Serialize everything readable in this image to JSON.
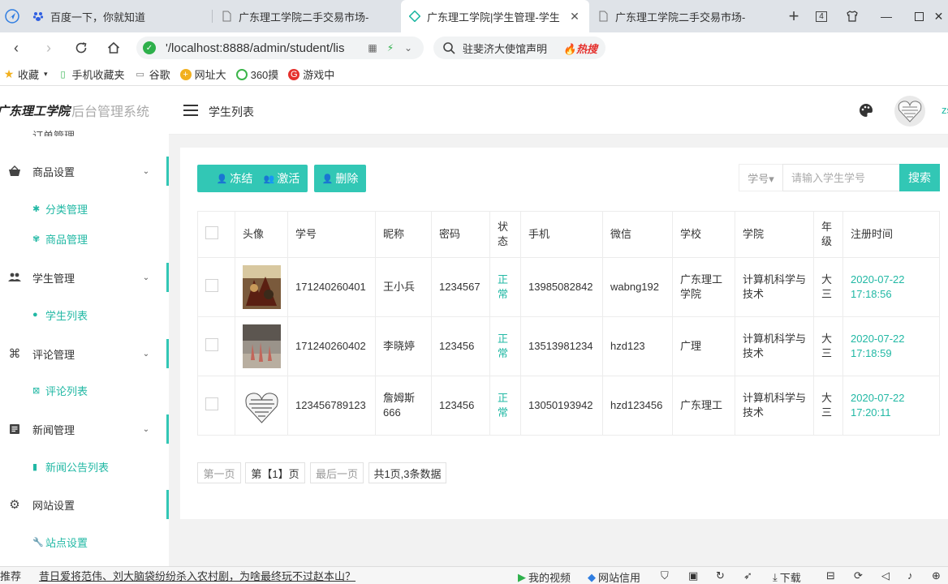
{
  "browser": {
    "tabs": [
      {
        "title": "百度一下，你就知道",
        "active": false
      },
      {
        "title": "广东理工学院二手交易市场-",
        "active": false
      },
      {
        "title": "广东理工学院|学生管理-学生",
        "active": true
      },
      {
        "title": "广东理工学院二手交易市场-",
        "active": false
      }
    ],
    "tab_count": "4",
    "url": "'/localhost:8888/admin/student/lis",
    "search_query": "驻斐济大使馆声明",
    "search_hot": "🔥热搜",
    "bookmarks": [
      "收藏",
      "手机收藏夹",
      "谷歌",
      "网址大",
      "360摸",
      "游戏中"
    ]
  },
  "app": {
    "school": "广东理工学院",
    "system_name": "后台管理系统",
    "page_title": "学生列表",
    "user_initial": "zs",
    "accent": "#32c7b5"
  },
  "sidebar": {
    "top_partial": "订单管理",
    "menus": [
      {
        "label": "商品设置",
        "icon": "basket-icon",
        "subs": [
          "分类管理",
          "商品管理"
        ]
      },
      {
        "label": "学生管理",
        "icon": "users-icon",
        "subs": [
          "学生列表"
        ]
      },
      {
        "label": "评论管理",
        "icon": "command-icon",
        "subs": [
          "评论列表"
        ]
      },
      {
        "label": "新闻管理",
        "icon": "news-icon",
        "subs": [
          "新闻公告列表"
        ]
      },
      {
        "label": "网站设置",
        "icon": "gear-icon",
        "subs": [
          "站点设置"
        ]
      }
    ]
  },
  "actions": {
    "freeze": "冻结",
    "activate": "激活",
    "delete": "删除",
    "search_field": "学号▾",
    "search_placeholder": "请输入学生学号",
    "search_button": "搜索"
  },
  "table": {
    "headers": [
      "",
      "头像",
      "学号",
      "昵称",
      "密码",
      "状态",
      "手机",
      "微信",
      "学校",
      "学院",
      "年级",
      "注册时间"
    ],
    "rows": [
      {
        "sn": "171240260401",
        "nickname": "王小兵",
        "password": "1234567",
        "status": "正常",
        "phone": "13985082842",
        "wechat": "wabng192",
        "school": "广东理工学院",
        "college": "计算机科学与技术",
        "grade": "大三",
        "registered": "2020-07-22 17:18:56"
      },
      {
        "sn": "171240260402",
        "nickname": "李晓婷",
        "password": "123456",
        "status": "正常",
        "phone": "13513981234",
        "wechat": "hzd123",
        "school": "广理",
        "college": "计算机科学与技术",
        "grade": "大三",
        "registered": "2020-07-22 17:18:59"
      },
      {
        "sn": "123456789123",
        "nickname": "詹姆斯666",
        "password": "123456",
        "status": "正常",
        "phone": "13050193942",
        "wechat": "hzd123456",
        "school": "广东理工",
        "college": "计算机科学与技术",
        "grade": "大三",
        "registered": "2020-07-22 17:20:11"
      }
    ]
  },
  "pagination": {
    "first": "第一页",
    "current": "第【1】页",
    "last": "最后一页",
    "summary": "共1页,3条数据"
  },
  "statusbar": {
    "left": "推荐",
    "news": "昔日爱将范伟、刘大脑袋纷纷杀入农村剧，为啥最终玩不过赵本山？",
    "my_video": "我的视频",
    "credit": "网站信用",
    "download": "下载"
  }
}
